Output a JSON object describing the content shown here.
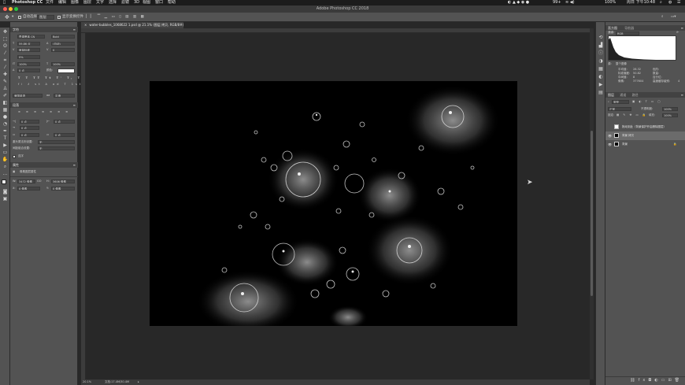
{
  "menubar": {
    "app": "Photoshop CC",
    "items": [
      "文件",
      "编辑",
      "图像",
      "图层",
      "文字",
      "选择",
      "滤镜",
      "3D",
      "视图",
      "窗口",
      "帮助"
    ],
    "battery": "100%",
    "clock": "周日 下午10:48",
    "misc": "99+"
  },
  "window": {
    "title": "Adobe Photoshop CC 2018"
  },
  "options": {
    "auto_select": "自动选择:",
    "target": "图层",
    "show_transform": "显示变换控件"
  },
  "tools": [
    "move",
    "marquee",
    "lasso",
    "magic-wand",
    "crop",
    "eyedropper",
    "heal",
    "brush",
    "stamp",
    "history-brush",
    "eraser",
    "gradient",
    "blur",
    "dodge",
    "pen",
    "type",
    "path-select",
    "shape",
    "hand",
    "zoom",
    "more",
    "colors",
    "quickmask",
    "screen-mode"
  ],
  "character": {
    "tab": "字符",
    "font": "思源黑体 CN",
    "style": "Bold",
    "size": "59.86 点",
    "leading": "(自动)",
    "kerning": "度量标准",
    "tracking": "0",
    "tsume": "0%",
    "vscale": "100%",
    "hscale": "100%",
    "baseline": "0 点",
    "color_label": "颜色:",
    "lang": "美国英语",
    "aa": "平滑"
  },
  "paragraph": {
    "tab": "段落",
    "indent_left": "0 点",
    "indent_right": "0 点",
    "first_line": "0 点",
    "space_before": "0 点",
    "space_after": "0 点",
    "kinsoku_label": "避头尾法则设置:",
    "kinsoku": "无",
    "mojikumi_label": "间距组合设置:",
    "mojikumi": "无",
    "hyphen": "连字"
  },
  "properties": {
    "tab": "属性",
    "title": "像素图层属性",
    "w_label": "W:",
    "w": "3472 像素",
    "h_label": "H:",
    "h": "3606 像素",
    "x_label": "X:",
    "x": "0 像素",
    "y_label": "Y:",
    "y": "0 像素",
    "go": "GO"
  },
  "document": {
    "tab": "water-bubbles_1068622 1.psd @ 21.1% (图层 拷贝, RGB/8#)",
    "zoom": "20.1%",
    "status": "文档:17.4M/30.4M"
  },
  "panel_icons": [
    "history",
    "histogram",
    "info",
    "navigator",
    "swatch",
    "adjust",
    "actions",
    "libraries"
  ],
  "histogram": {
    "tabs": [
      "直方图",
      "导航器"
    ],
    "channel_label": "通道:",
    "channel": "RGB",
    "source_label": "源:",
    "source": "整个图像",
    "stats": [
      [
        "平均值:",
        "28.32",
        "色阶:",
        ""
      ],
      [
        "标准偏差:",
        "50.82",
        "数量:",
        ""
      ],
      [
        "中间值:",
        "8",
        "百分位:",
        ""
      ],
      [
        "像素:",
        "377604",
        "高速缓存级别:",
        "4"
      ]
    ]
  },
  "layers": {
    "tabs": [
      "图层",
      "通道",
      "路径"
    ],
    "kind": "类型",
    "blend": "正常",
    "opacity_label": "不透明度:",
    "opacity": "100%",
    "lock_label": "锁定:",
    "fill_label": "填充:",
    "fill": "100%",
    "rows": [
      {
        "name": "拖动到此（背景保护开启删除图层）",
        "selected": false,
        "visible": false
      },
      {
        "name": "背景 拷贝",
        "selected": true,
        "visible": true
      },
      {
        "name": "背景",
        "selected": false,
        "visible": true
      }
    ],
    "footer_icons": [
      "link",
      "fx",
      "mask",
      "adjust",
      "group",
      "new",
      "delete"
    ]
  },
  "colors": {
    "accent": "#1473e6",
    "panel": "#535353",
    "canvas_bg": "#282828"
  }
}
